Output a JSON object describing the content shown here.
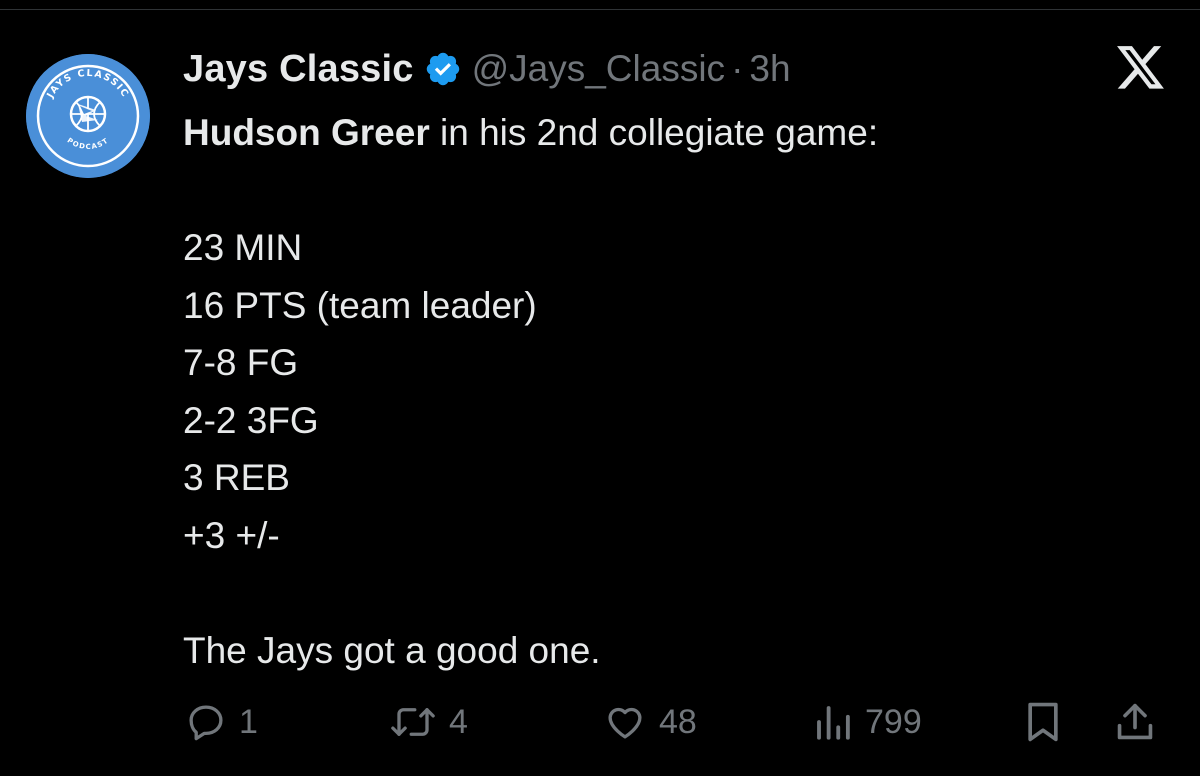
{
  "author": {
    "display_name": "Jays Classic",
    "handle": "@Jays_Classic",
    "separator": "·",
    "time": "3h",
    "verified": true,
    "avatar_text_top": "JAYS CLASSIC",
    "avatar_text_bottom": "PODCAST"
  },
  "tweet": {
    "intro_name": "Hudson Greer",
    "intro_rest": " in his 2nd collegiate game:",
    "stats": [
      "23 MIN",
      "16 PTS (team leader)",
      "7-8 FG",
      "2-2 3FG",
      "3 REB",
      "+3 +/-"
    ],
    "closing": "The Jays got a good one."
  },
  "actions": {
    "replies": "1",
    "reposts": "4",
    "likes": "48",
    "views": "799"
  },
  "colors": {
    "background": "#000000",
    "text": "#e7e9ea",
    "muted": "#71767b",
    "verified": "#1d9bf0",
    "avatar": "#4a8fd8"
  },
  "icons": {
    "reply": "comment-icon",
    "repost": "repost-icon",
    "like": "heart-icon",
    "views": "views-bar-icon",
    "bookmark": "bookmark-icon",
    "share": "share-icon",
    "logo": "x-logo-icon",
    "verified": "verified-badge-icon"
  }
}
